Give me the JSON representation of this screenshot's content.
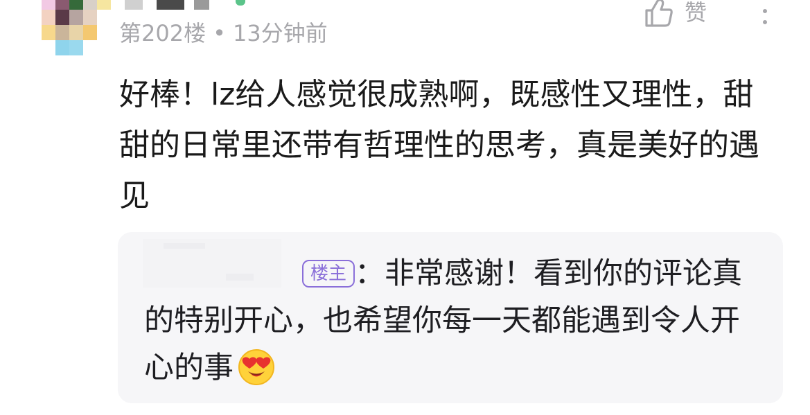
{
  "comment": {
    "floor": "第202楼",
    "separator": "•",
    "time": "13分钟前",
    "like_label": "赞",
    "text": "好棒！lz给人感觉很成熟啊，既感性又理性，甜甜的日常里还带有哲理性的思考，真是美好的遇见",
    "icons": {
      "like": "thumbs-up-icon",
      "more": "more-vertical-icon"
    }
  },
  "reply": {
    "author_badge": "楼主",
    "colon": "：",
    "text": "非常感谢！看到你的评论真的特别开心，也希望你每一天都能遇到令人开心的事",
    "emoji": "heart-eyes-emoji-icon"
  },
  "colors": {
    "badge": "#8a6fd9",
    "meta_text": "#a7a7ab",
    "reply_bg": "#f6f6f8"
  }
}
